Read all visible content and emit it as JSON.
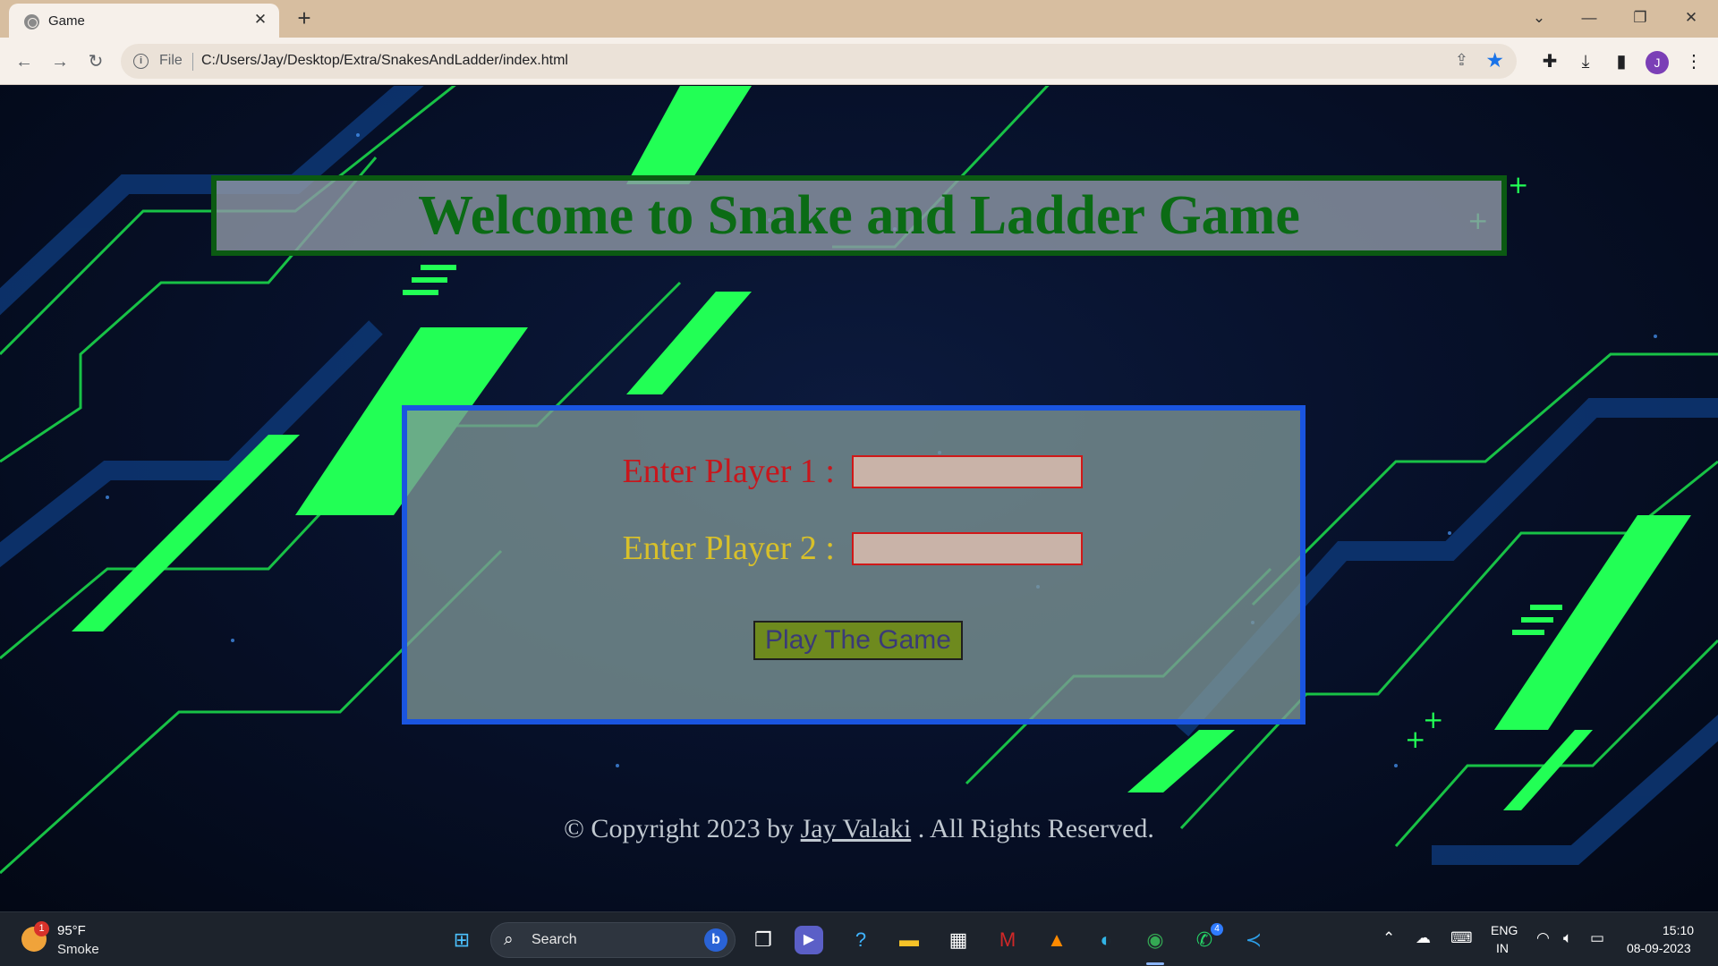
{
  "browser": {
    "tab_title": "Game",
    "tab_close": "✕",
    "new_tab": "+",
    "url_scheme_label": "File",
    "url": "C:/Users/Jay/Desktop/Extra/SnakesAndLadder/index.html",
    "window_controls": {
      "dropdown": "⌄",
      "minimize": "—",
      "restore": "❐",
      "close": "✕"
    },
    "avatar_letter": "J",
    "icons": [
      "back-arrow-icon",
      "forward-arrow-icon",
      "reload-icon",
      "info-icon",
      "share-icon",
      "star-icon",
      "extensions-icon",
      "download-icon",
      "sidepanel-icon",
      "menu-icon"
    ]
  },
  "page": {
    "title": "Welcome to Snake and Ladder Game",
    "player1_label": "Enter Player 1 :",
    "player2_label": "Enter Player 2 :",
    "player1_value": "",
    "player2_value": "",
    "play_button": "Play The Game",
    "footer_prefix": "© Copyright 2023 by",
    "footer_author": "Jay Valaki",
    "footer_suffix": ". All Rights Reserved.",
    "colors": {
      "title_text": "#0b6b15",
      "title_border": "#0b5a12",
      "form_border": "#1a55e0",
      "player1_label": "#c8161c",
      "player2_label": "#d8c02a",
      "button_bg": "#6e8a1e",
      "accent_green": "#22ff55"
    }
  },
  "taskbar": {
    "weather_temp": "95°F",
    "weather_condition": "Smoke",
    "weather_badge": "1",
    "search_label": "Search",
    "whatsapp_badge": "4",
    "language_line1": "ENG",
    "language_line2": "IN",
    "time": "15:10",
    "date": "08-09-2023",
    "pinned_apps": [
      "start-icon",
      "task-view-icon",
      "teams-icon",
      "copilot-icon",
      "file-explorer-icon",
      "store-icon",
      "mcafee-icon",
      "vlc-icon",
      "edge-icon",
      "chrome-icon",
      "whatsapp-icon",
      "vscode-icon"
    ]
  }
}
